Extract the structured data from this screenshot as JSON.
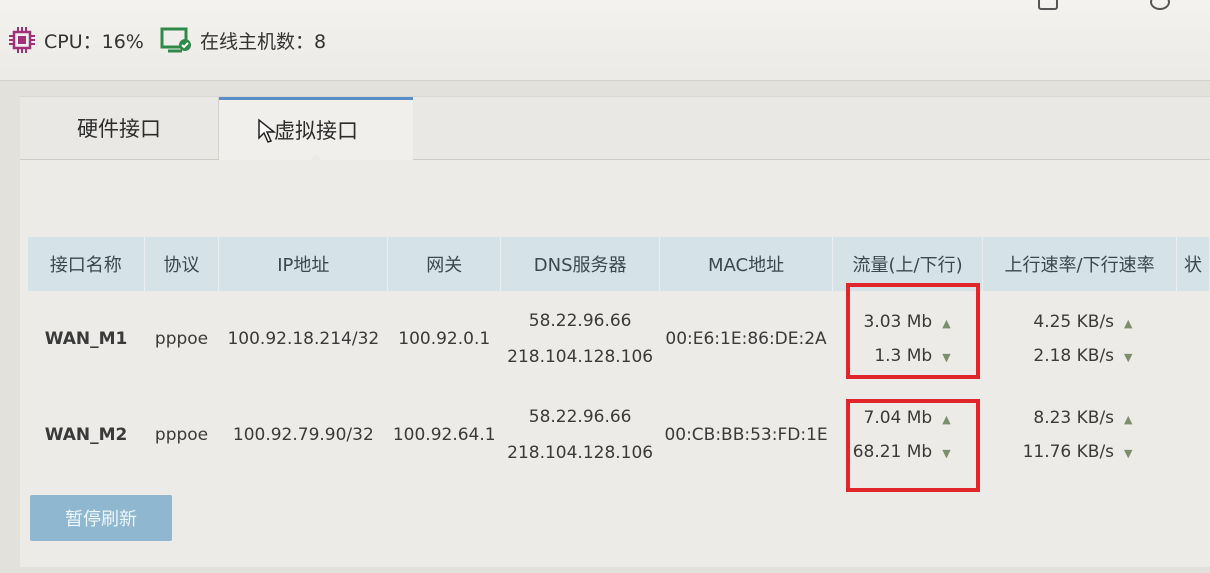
{
  "topbar": {
    "cpu_text": "CPU：16%",
    "hosts_text": "在线主机数：8"
  },
  "tabs": [
    {
      "label": "硬件接口",
      "active": false
    },
    {
      "label": "虚拟接口",
      "active": true
    }
  ],
  "table": {
    "headers": [
      "接口名称",
      "协议",
      "IP地址",
      "网关",
      "DNS服务器",
      "MAC地址",
      "流量(上/下行)",
      "上行速率/下行速率",
      "状"
    ],
    "rows": [
      {
        "name": "WAN_M1",
        "protocol": "pppoe",
        "ip": "100.92.18.214/32",
        "gateway": "100.92.0.1",
        "dns1": "58.22.96.66",
        "dns2": "218.104.128.106",
        "mac": "00:E6:1E:86:DE:2A",
        "traffic_up": "3.03 Mb",
        "traffic_down": "1.3 Mb",
        "rate_up": "4.25 KB/s",
        "rate_down": "2.18 KB/s"
      },
      {
        "name": "WAN_M2",
        "protocol": "pppoe",
        "ip": "100.92.79.90/32",
        "gateway": "100.92.64.1",
        "dns1": "58.22.96.66",
        "dns2": "218.104.128.106",
        "mac": "00:CB:BB:53:FD:1E",
        "traffic_up": "7.04 Mb",
        "traffic_down": "68.21 Mb",
        "rate_up": "8.23 KB/s",
        "rate_down": "11.76 KB/s"
      }
    ]
  },
  "pause_button": "暂停刷新",
  "icons": {
    "cpu": "cpu-chip-icon",
    "hosts": "monitor-icon",
    "up": "arrow-up-icon",
    "down": "arrow-down-icon"
  },
  "colors": {
    "highlight": "#e0262a",
    "header_bg": "#d5e2e8",
    "button_bg": "#8fb7cf",
    "active_tab_border": "#5a8ec6",
    "cpu_icon": "#a0307a",
    "host_icon": "#2f8a4a"
  }
}
